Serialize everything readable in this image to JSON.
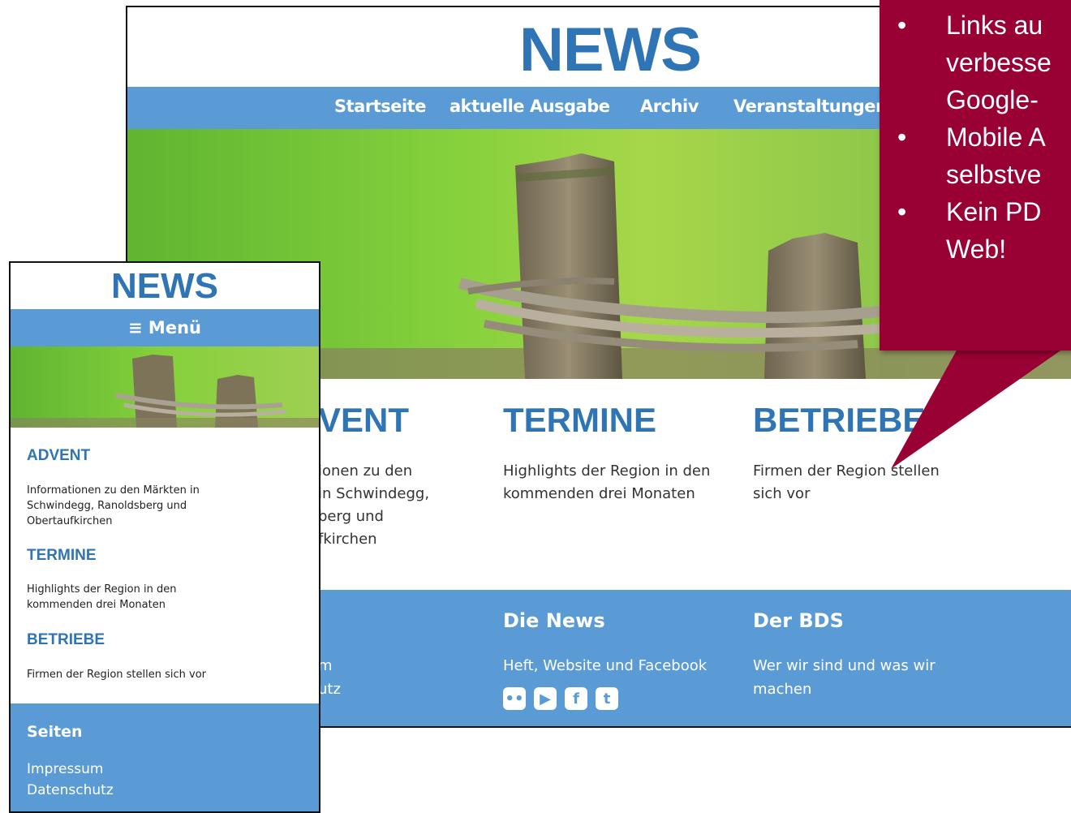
{
  "desktop": {
    "logo": "NEWS",
    "nav": [
      "Startseite",
      "aktuelle Ausgabe",
      "Archiv",
      "Veranstaltungen"
    ],
    "columns": [
      {
        "title": "ADVENT",
        "visible_title": "VENT",
        "lines": [
          "ionen zu den",
          "in Schwindegg,",
          "berg und",
          "fkirchen"
        ]
      },
      {
        "title": "TERMINE",
        "text": "Highlights der Region in den kommenden drei Monaten"
      },
      {
        "title": "BETRIEBE",
        "text": "Firmen der Region stellen sich vor"
      }
    ],
    "footer": {
      "col1_lines": [
        "m",
        "utz"
      ],
      "news_title": "Die News",
      "news_text": "Heft, Website und Facebook",
      "bds_title": "Der BDS",
      "bds_text": "Wer wir sind und was wir machen",
      "social_icons": [
        "flickr-icon",
        "youtube-icon",
        "facebook-icon",
        "twitter-icon"
      ]
    }
  },
  "callout": {
    "color": "#990033",
    "items": [
      "Links au\nverbesse\nGoogle-",
      "Mobile A\nselbstve",
      "Kein PD\nWeb!"
    ]
  },
  "mobile": {
    "logo": "NEWS",
    "menu_label": "≡ Menü",
    "sections": [
      {
        "title": "ADVENT",
        "text": "Informationen zu den Märkten in Schwindegg, Ranoldsberg und Obertaufkirchen"
      },
      {
        "title": "TERMINE",
        "text": "Highlights der Region in den kommenden drei Monaten"
      },
      {
        "title": "BETRIEBE",
        "text": "Firmen der Region stellen sich vor"
      }
    ],
    "footer": {
      "title": "Seiten",
      "links": [
        "Impressum",
        "Datenschutz"
      ]
    }
  },
  "colors": {
    "brand_blue": "#2f74b5",
    "bar_blue": "#5b9bd5",
    "callout": "#990033"
  }
}
